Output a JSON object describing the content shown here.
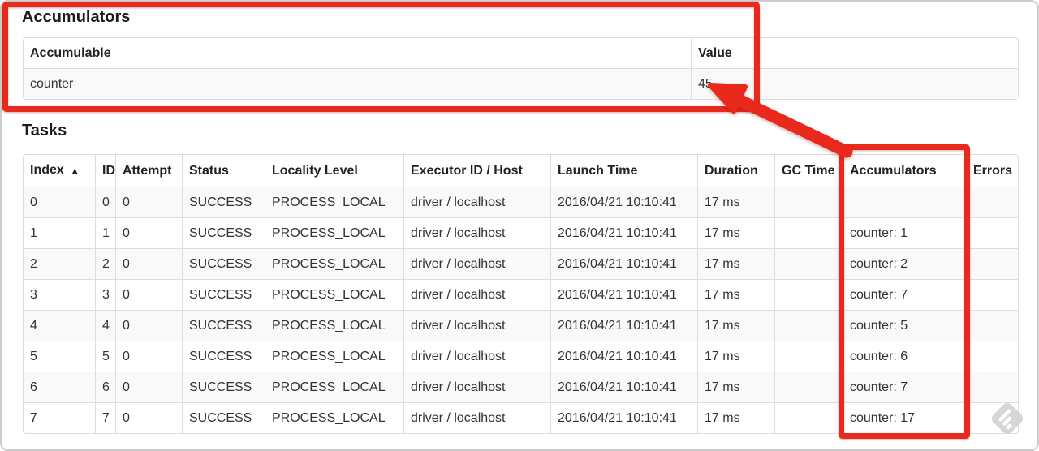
{
  "colors": {
    "annotation_red": "#e8291c",
    "table_border": "#dddddd",
    "row_stripe": "#f9f9f9",
    "watermark_gray": "#d4d4d4"
  },
  "accumulators_section": {
    "title": "Accumulators",
    "table": {
      "columns": [
        "Accumulable",
        "Value"
      ],
      "rows": [
        [
          "counter",
          "45"
        ]
      ]
    }
  },
  "tasks_section": {
    "title": "Tasks",
    "table": {
      "columns": [
        "Index",
        "ID",
        "Attempt",
        "Status",
        "Locality Level",
        "Executor ID / Host",
        "Launch Time",
        "Duration",
        "GC Time",
        "Accumulators",
        "Errors"
      ],
      "sort": {
        "column": "Index",
        "direction": "asc",
        "indicator": "▲"
      },
      "rows": [
        [
          "0",
          "0",
          "0",
          "SUCCESS",
          "PROCESS_LOCAL",
          "driver / localhost",
          "2016/04/21 10:10:41",
          "17 ms",
          "",
          "",
          ""
        ],
        [
          "1",
          "1",
          "0",
          "SUCCESS",
          "PROCESS_LOCAL",
          "driver / localhost",
          "2016/04/21 10:10:41",
          "17 ms",
          "",
          "counter: 1",
          ""
        ],
        [
          "2",
          "2",
          "0",
          "SUCCESS",
          "PROCESS_LOCAL",
          "driver / localhost",
          "2016/04/21 10:10:41",
          "17 ms",
          "",
          "counter: 2",
          ""
        ],
        [
          "3",
          "3",
          "0",
          "SUCCESS",
          "PROCESS_LOCAL",
          "driver / localhost",
          "2016/04/21 10:10:41",
          "17 ms",
          "",
          "counter: 7",
          ""
        ],
        [
          "4",
          "4",
          "0",
          "SUCCESS",
          "PROCESS_LOCAL",
          "driver / localhost",
          "2016/04/21 10:10:41",
          "17 ms",
          "",
          "counter: 5",
          ""
        ],
        [
          "5",
          "5",
          "0",
          "SUCCESS",
          "PROCESS_LOCAL",
          "driver / localhost",
          "2016/04/21 10:10:41",
          "17 ms",
          "",
          "counter: 6",
          ""
        ],
        [
          "6",
          "6",
          "0",
          "SUCCESS",
          "PROCESS_LOCAL",
          "driver / localhost",
          "2016/04/21 10:10:41",
          "17 ms",
          "",
          "counter: 7",
          ""
        ],
        [
          "7",
          "7",
          "0",
          "SUCCESS",
          "PROCESS_LOCAL",
          "driver / localhost",
          "2016/04/21 10:10:41",
          "17 ms",
          "",
          "counter: 17",
          ""
        ]
      ]
    }
  }
}
